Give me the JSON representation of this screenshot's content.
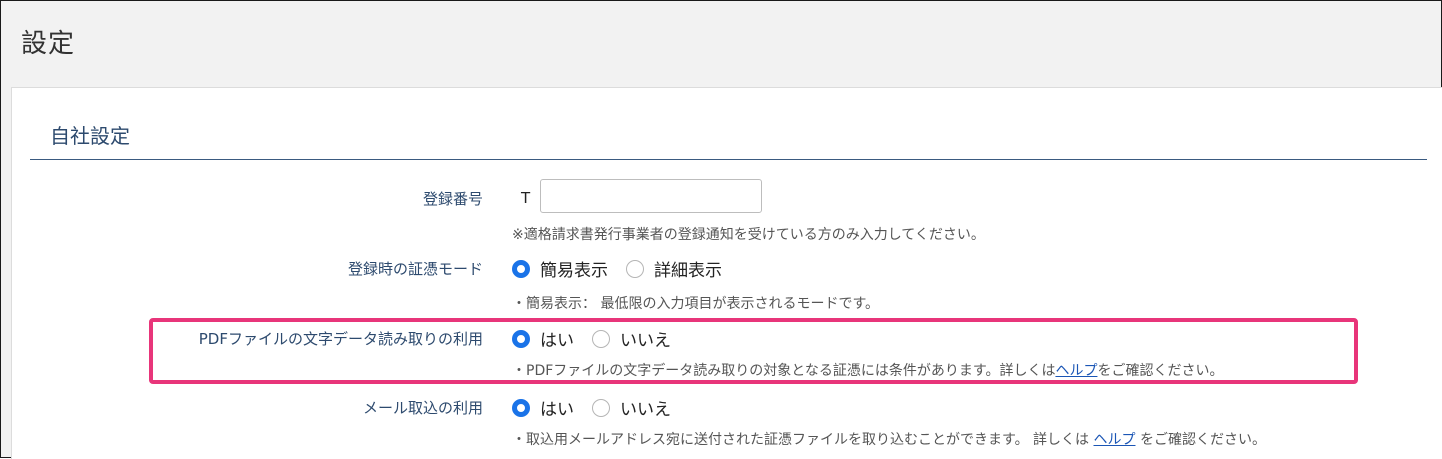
{
  "page": {
    "title": "設定"
  },
  "section": {
    "title": "自社設定"
  },
  "registration_number": {
    "label": "登録番号",
    "prefix": "T",
    "value": "",
    "note": "※適格請求書発行事業者の登録通知を受けている方のみ入力してください。"
  },
  "voucher_mode": {
    "label": "登録時の証憑モード",
    "options": [
      {
        "label": "簡易表示",
        "selected": true
      },
      {
        "label": "詳細表示",
        "selected": false
      }
    ],
    "note": "・簡易表示： 最低限の入力項目が表示されるモードです。"
  },
  "pdf_text_read": {
    "label": "PDFファイルの文字データ読み取りの利用",
    "options": [
      {
        "label": "はい",
        "selected": true
      },
      {
        "label": "いいえ",
        "selected": false
      }
    ],
    "note_before": "・PDFファイルの文字データ読み取りの対象となる証憑には条件があります。詳しくは",
    "note_link": "ヘルプ",
    "note_after": "をご確認ください。"
  },
  "mail_import": {
    "label": "メール取込の利用",
    "options": [
      {
        "label": "はい",
        "selected": true
      },
      {
        "label": "いいえ",
        "selected": false
      }
    ],
    "note_before": "・取込用メールアドレス宛に送付された証憑ファイルを取り込むことができます。 詳しくは ",
    "note_link": "ヘルプ",
    "note_after": " をご確認ください。"
  },
  "colors": {
    "accent": "#1a73e8",
    "highlight": "#e8357a",
    "label": "#2d4a6e"
  }
}
